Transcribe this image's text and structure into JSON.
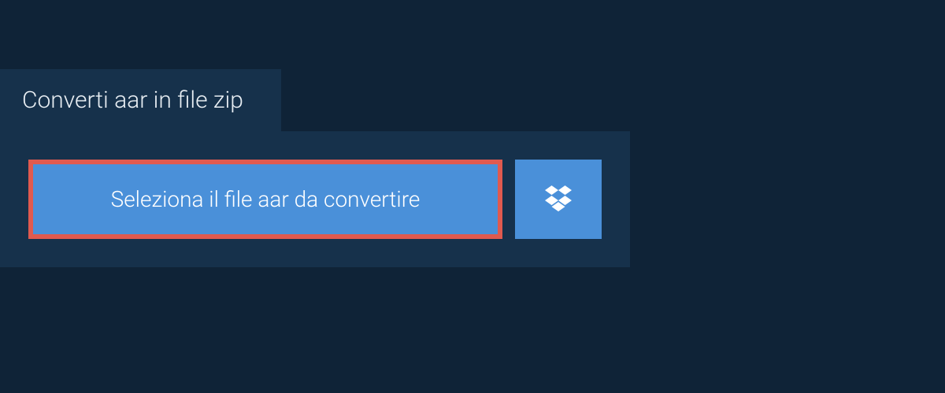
{
  "tab": {
    "label": "Converti aar in file zip"
  },
  "panel": {
    "select_button_label": "Seleziona il file aar da convertire"
  }
}
